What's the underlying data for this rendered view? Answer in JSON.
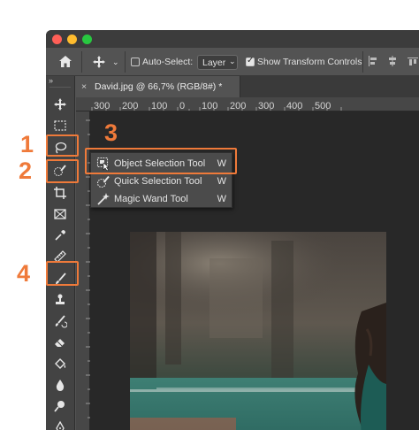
{
  "window": {
    "traffic_lights": [
      "#ff5f57",
      "#febc2e",
      "#28c840"
    ]
  },
  "options_bar": {
    "home_icon": "home-icon",
    "move_icon": "move-arrows-icon",
    "auto_select_label": "Auto-Select:",
    "auto_select_checked": false,
    "layer_value": "Layer",
    "show_transform_label": "Show Transform Controls",
    "show_transform_checked": true,
    "collapse_glyph": "»"
  },
  "document": {
    "tab_title": "David.jpg @ 66,7% (RGB/8#) *",
    "close_glyph": "×",
    "ruler_ticks": [
      "300",
      "200",
      "100",
      "0",
      "100",
      "200",
      "300",
      "400",
      "500"
    ]
  },
  "flyout": {
    "items": [
      {
        "label": "Object Selection Tool",
        "shortcut": "W",
        "icon": "object-selection-icon"
      },
      {
        "label": "Quick Selection Tool",
        "shortcut": "W",
        "icon": "quick-selection-icon"
      },
      {
        "label": "Magic Wand Tool",
        "shortcut": "W",
        "icon": "magic-wand-icon"
      }
    ]
  },
  "tools": [
    "move",
    "marquee",
    "lasso",
    "object-selection",
    "crop",
    "frame",
    "eyedropper",
    "ruler",
    "brush",
    "clone-stamp",
    "history-brush",
    "eraser",
    "paint-bucket",
    "blur",
    "dodge",
    "pen"
  ],
  "callouts": {
    "one": "1",
    "two": "2",
    "three": "3",
    "four": "4",
    "color": "#ef7a3a"
  }
}
